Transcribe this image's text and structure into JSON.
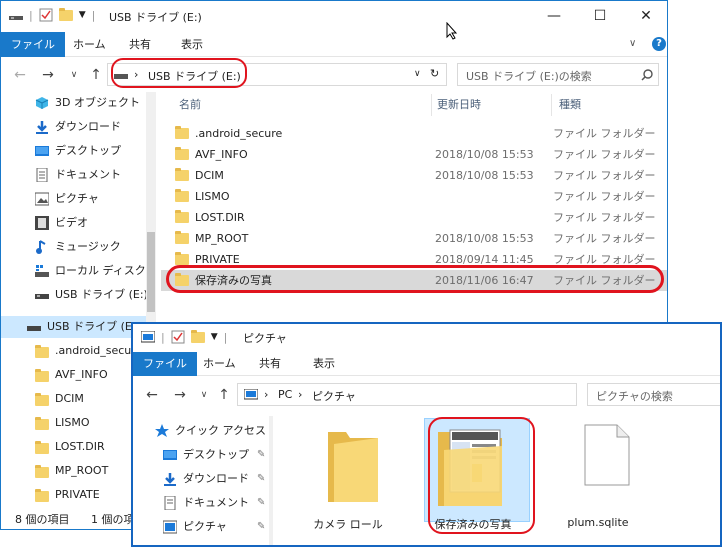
{
  "win1": {
    "title": "USB ドライブ (E:)",
    "ribbon_tabs": [
      "ファイル",
      "ホーム",
      "共有",
      "表示"
    ],
    "address": {
      "arrow": "›",
      "path": "USB ドライブ (E:)"
    },
    "search_placeholder": "USB ドライブ (E:)の検索",
    "columns": {
      "name": "名前",
      "modified": "更新日時",
      "type": "種類"
    },
    "nav_items": [
      {
        "label": "3D オブジェクト",
        "icon": "3d-objects-icon"
      },
      {
        "label": "ダウンロード",
        "icon": "download-icon"
      },
      {
        "label": "デスクトップ",
        "icon": "desktop-icon"
      },
      {
        "label": "ドキュメント",
        "icon": "document-icon"
      },
      {
        "label": "ピクチャ",
        "icon": "pictures-icon"
      },
      {
        "label": "ビデオ",
        "icon": "video-icon"
      },
      {
        "label": "ミュージック",
        "icon": "music-icon"
      },
      {
        "label": "ローカル ディスク (C",
        "icon": "local-disk-icon"
      },
      {
        "label": "USB ドライブ (E:)",
        "icon": "usb-drive-icon"
      }
    ],
    "nav_tree": {
      "drive_label": "USB ドライブ (E:)",
      "children": [
        ".android_secur",
        "AVF_INFO",
        "DCIM",
        "LISMO",
        "LOST.DIR",
        "MP_ROOT",
        "PRIVATE"
      ]
    },
    "files": [
      {
        "name": ".android_secure",
        "modified": "",
        "type": "ファイル フォルダー"
      },
      {
        "name": "AVF_INFO",
        "modified": "2018/10/08 15:53",
        "type": "ファイル フォルダー"
      },
      {
        "name": "DCIM",
        "modified": "2018/10/08 15:53",
        "type": "ファイル フォルダー"
      },
      {
        "name": "LISMO",
        "modified": "",
        "type": "ファイル フォルダー"
      },
      {
        "name": "LOST.DIR",
        "modified": "",
        "type": "ファイル フォルダー"
      },
      {
        "name": "MP_ROOT",
        "modified": "2018/10/08 15:53",
        "type": "ファイル フォルダー"
      },
      {
        "name": "PRIVATE",
        "modified": "2018/09/14 11:45",
        "type": "ファイル フォルダー"
      },
      {
        "name": "保存済みの写真",
        "modified": "2018/11/06 16:47",
        "type": "ファイル フォルダー"
      }
    ],
    "status": {
      "count": "8 個の項目",
      "selected": "1 個の項"
    },
    "controls": {
      "minimize": "—",
      "maximize": "☐",
      "close": "✕",
      "chevron": "∨",
      "help": "?"
    }
  },
  "win2": {
    "title": "ピクチャ",
    "ribbon_tabs": [
      "ファイル",
      "ホーム",
      "共有",
      "表示"
    ],
    "address": {
      "pc": "PC",
      "arrow": "›",
      "path": "ピクチャ"
    },
    "search_placeholder": "ピクチャの検索",
    "nav_items": [
      {
        "label": "クイック アクセス",
        "icon": "star-icon"
      },
      {
        "label": "デスクトップ",
        "icon": "desktop-icon"
      },
      {
        "label": "ダウンロード",
        "icon": "download-icon"
      },
      {
        "label": "ドキュメント",
        "icon": "document-icon"
      },
      {
        "label": "ピクチャ",
        "icon": "pictures-icon"
      }
    ],
    "tiles": [
      {
        "label": "カメラ ロール",
        "icon": "folder-icon"
      },
      {
        "label": "保存済みの写真",
        "icon": "folder-with-preview-icon"
      },
      {
        "label": "plum.sqlite",
        "icon": "file-icon"
      }
    ]
  },
  "colors": {
    "accent": "#1979ca",
    "highlight": "#e0141e",
    "folder": "#f5d26a"
  }
}
